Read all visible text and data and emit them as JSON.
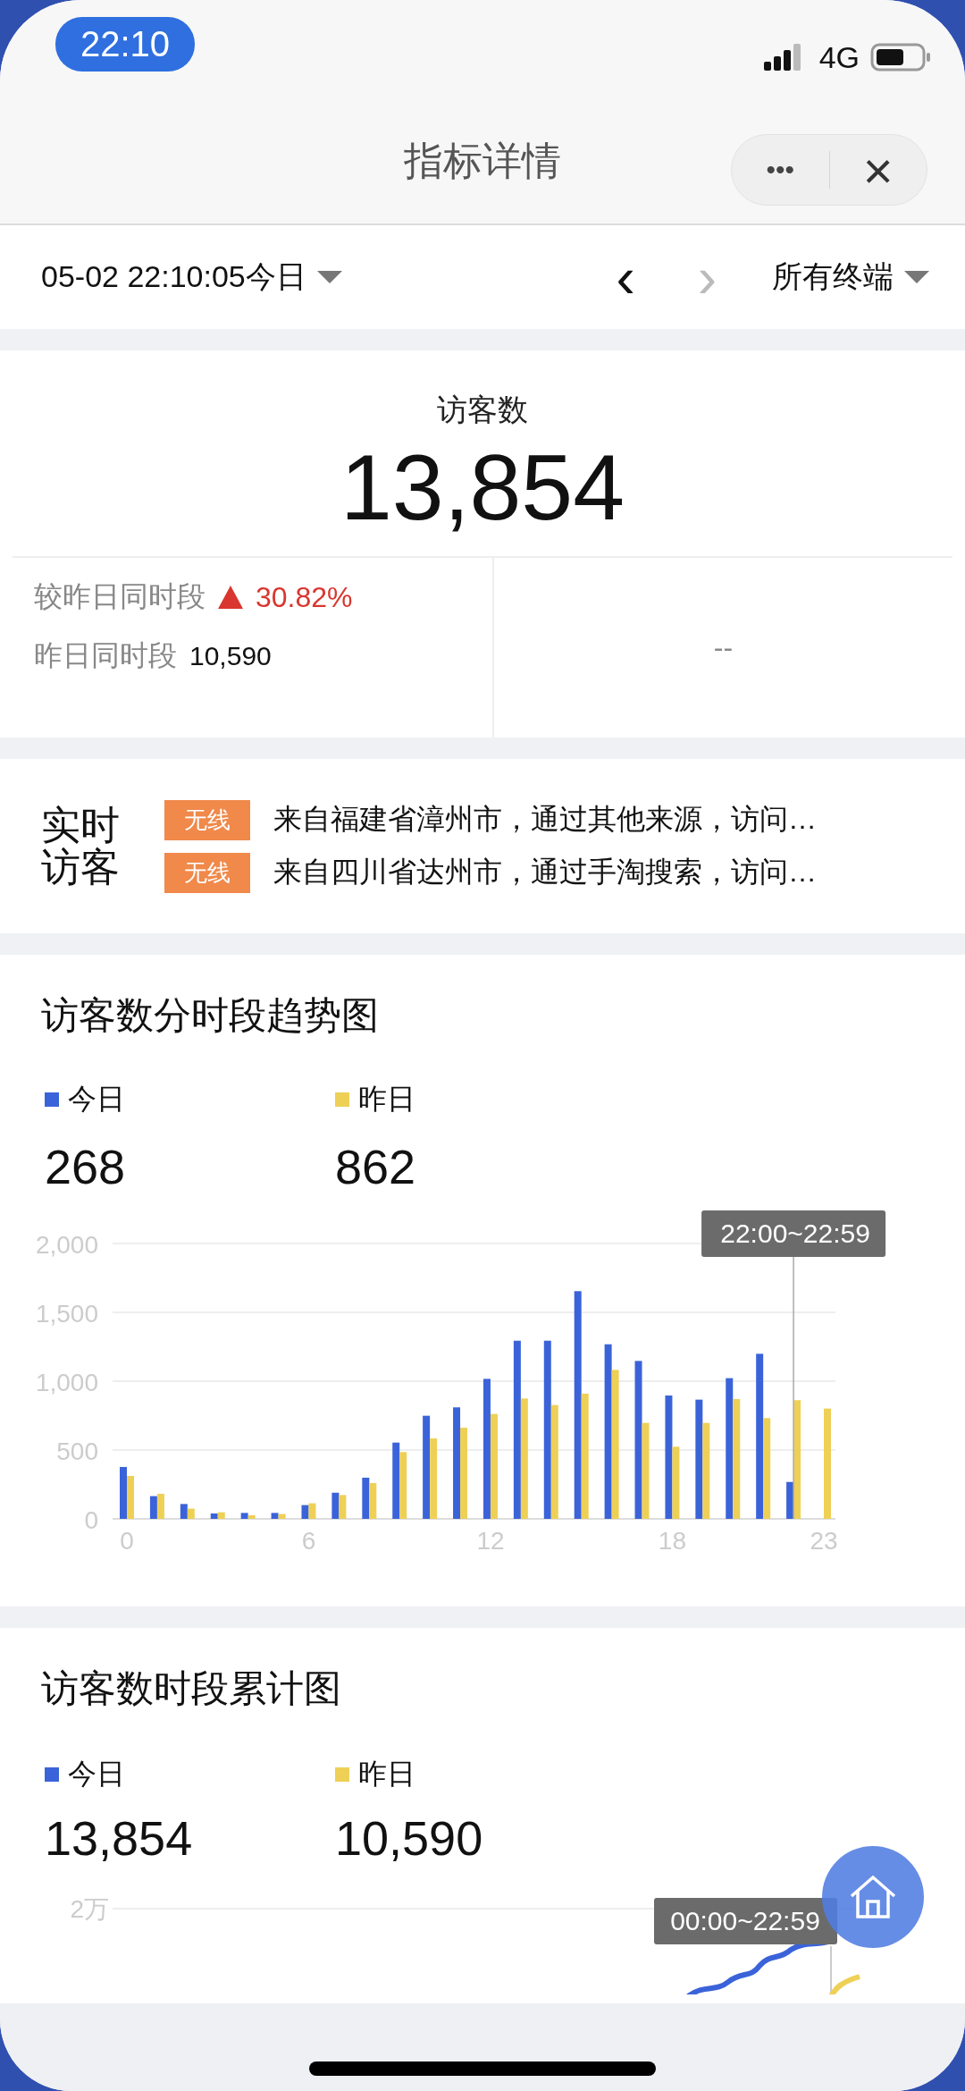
{
  "status_bar": {
    "time": "22:10",
    "network": "4G"
  },
  "nav": {
    "title": "指标详情",
    "more": "•••",
    "close": "×"
  },
  "filter": {
    "date": "05-02 22:10:05今日",
    "prev": "‹",
    "next": "›",
    "next_disabled": true,
    "terminal": "所有终端"
  },
  "metric": {
    "label": "访客数",
    "value": "13,854",
    "compare_label": "较昨日同时段",
    "change": "30.82%",
    "rising": true,
    "yesterday_label": "昨日同时段",
    "yesterday_value": "10,590",
    "right_value": "--"
  },
  "realtime": {
    "title": "实时访客",
    "items": [
      {
        "badge": "无线",
        "text": "来自福建省漳州市，通过其他来源，访问…"
      },
      {
        "badge": "无线",
        "text": "来自四川省达州市，通过手淘搜索，访问…"
      }
    ]
  },
  "trend_chart": {
    "title": "访客数分时段趋势图",
    "legend": [
      {
        "value": "268"
      },
      {
        "value": "862"
      }
    ],
    "chart_data": {
      "type": "bar",
      "x": [
        0,
        1,
        2,
        3,
        4,
        5,
        6,
        7,
        8,
        9,
        10,
        11,
        12,
        13,
        14,
        15,
        16,
        17,
        18,
        19,
        20,
        21,
        22,
        23
      ],
      "xlim": [
        0,
        23
      ],
      "grid": true,
      "xticks": [
        0,
        6,
        12,
        18,
        23
      ],
      "yticks": [
        0,
        500,
        {
          "value": 1000,
          "label": "1,000"
        },
        {
          "value": 1500,
          "label": "1,500"
        },
        {
          "value": 2000,
          "label": "2,000"
        }
      ],
      "ylim": [
        0,
        2000
      ],
      "series": [
        {
          "name": "今日",
          "color": "#3b63d9",
          "values": [
            377,
            165,
            108,
            39,
            43,
            43,
            100,
            190,
            299,
            554,
            749,
            810,
            1017,
            1294,
            1294,
            1654,
            1268,
            1147,
            896,
            866,
            1022,
            1199,
            268,
            null
          ]
        },
        {
          "name": "昨日",
          "color": "#eed057",
          "values": [
            312,
            182,
            74,
            48,
            26,
            35,
            113,
            173,
            260,
            485,
            584,
            662,
            762,
            874,
            827,
            909,
            1082,
            697,
            524,
            697,
            870,
            732,
            862,
            801
          ]
        }
      ],
      "ref_lines": [
        {
          "axis": "x",
          "value": 22
        }
      ],
      "annotations": [
        "22:00~22:59"
      ]
    }
  },
  "cumulative_chart": {
    "title": "访客数时段累计图",
    "legend": [
      {
        "name": "今日",
        "color": "#3b63d9",
        "value": "13,854"
      },
      {
        "name": "昨日",
        "color": "#eed057",
        "value": "10,590"
      }
    ],
    "y_tick_label": "2万",
    "tooltip": "00:00~22:59"
  },
  "home_button": {
    "kind": "home"
  }
}
